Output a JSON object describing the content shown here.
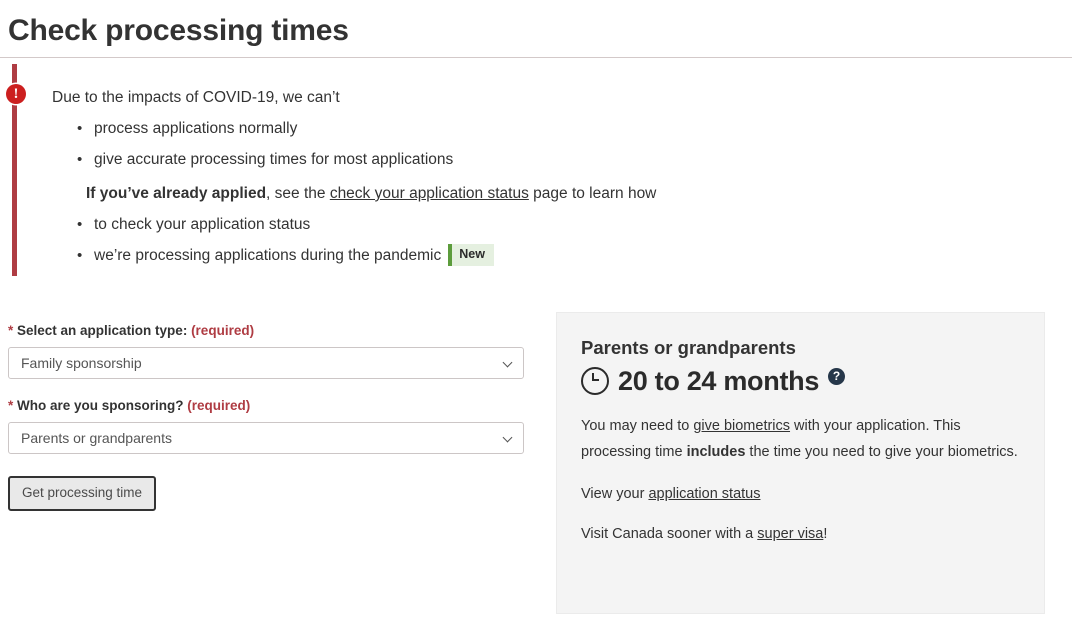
{
  "page": {
    "title": "Check processing times"
  },
  "alert": {
    "icon": "exclamation-circle-icon",
    "lead": "Due to the impacts of COVID-19, we can’t",
    "bullets_top": [
      "process applications normally",
      "give accurate processing times for most applications"
    ],
    "applied_bold": "If you’ve already applied",
    "applied_mid": ", see the ",
    "applied_link": "check your application status",
    "applied_tail": " page to learn how",
    "bullets_bottom": [
      "to check your application status",
      "we’re processing applications during the pandemic"
    ],
    "new_badge": "New",
    "accent_color": "#af3c43",
    "badge_bg": "#e5f0e0",
    "badge_border": "#5c9c3c"
  },
  "form": {
    "application_type": {
      "label_star": "*",
      "label_text": " Select an application type: ",
      "label_required": "(required)",
      "value": "Family sponsorship",
      "options": [
        "Family sponsorship"
      ]
    },
    "sponsoring": {
      "label_star": "*",
      "label_text": " Who are you sponsoring? ",
      "label_required": "(required)",
      "value": "Parents or grandparents",
      "options": [
        "Parents or grandparents"
      ]
    },
    "submit_label": "Get processing time",
    "required_color": "#af3c43"
  },
  "result": {
    "subject": "Parents or grandparents",
    "clock_icon": "clock-icon",
    "time": "20 to 24 months",
    "help_icon": "?",
    "biometrics_pre": "You may need to ",
    "biometrics_link": "give biometrics",
    "biometrics_mid": " with your application. This processing time ",
    "biometrics_bold": "includes",
    "biometrics_tail": " the time you need to give your biometrics.",
    "status_pre": "View your ",
    "status_link": "application status",
    "supervisa_pre": "Visit Canada sooner with a ",
    "supervisa_link": "super visa",
    "supervisa_tail": "!",
    "panel_bg": "#f4f4f4",
    "help_icon_color": "#26374a"
  }
}
